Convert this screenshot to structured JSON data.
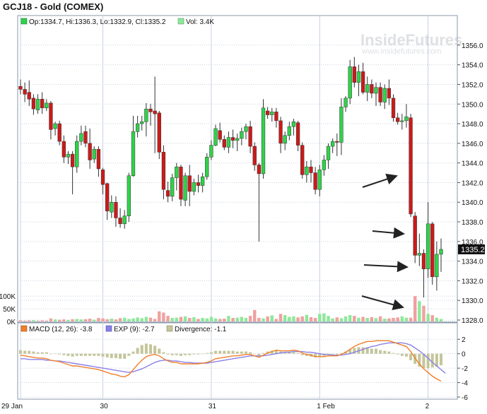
{
  "header": {
    "title": "GCJ18 - Gold (COMEX)",
    "ohlc": "Op:1334.7, Hi:1336.3, Lo:1332.9, Cl:1335.2",
    "vol": "Vol: 3.4K"
  },
  "watermark": {
    "brand": "InsideFutures",
    "url": "www.insidefutures.com"
  },
  "colors": {
    "up": "#2fd34a",
    "down": "#cc1a1a",
    "vol_up": "#8ee89a",
    "vol_down": "#f0a0a0",
    "macd": "#ef7f2a",
    "exp": "#8a80e8",
    "divergence": "#c4c59a",
    "grid": "#c8d0e0",
    "arrow": "#222222"
  },
  "chart_data": [
    {
      "type": "candlestick",
      "name": "price",
      "title": "GCJ18 - Gold (COMEX)",
      "ylim": [
        1328.0,
        1357.0
      ],
      "yticks": [
        "1356.0",
        "1354.0",
        "1352.0",
        "1350.0",
        "1348.0",
        "1346.0",
        "1344.0",
        "1342.0",
        "1340.0",
        "1338.0",
        "1336.0",
        "1334.0",
        "1332.0",
        "1330.0",
        "1328.0"
      ],
      "last_price_label": "1335.2",
      "xticks": [
        "29 Jan",
        "30",
        "31",
        "1 Feb",
        "2"
      ],
      "candles": [
        {
          "o": 1351.8,
          "h": 1352.5,
          "l": 1351.0,
          "c": 1351.5
        },
        {
          "o": 1351.5,
          "h": 1352.2,
          "l": 1350.2,
          "c": 1351.0
        },
        {
          "o": 1351.2,
          "h": 1352.4,
          "l": 1349.8,
          "c": 1350.5
        },
        {
          "o": 1350.6,
          "h": 1351.0,
          "l": 1348.9,
          "c": 1349.5
        },
        {
          "o": 1349.4,
          "h": 1351.0,
          "l": 1349.0,
          "c": 1350.5
        },
        {
          "o": 1350.5,
          "h": 1351.2,
          "l": 1349.0,
          "c": 1349.6
        },
        {
          "o": 1349.6,
          "h": 1350.5,
          "l": 1349.3,
          "c": 1350.1
        },
        {
          "o": 1350.1,
          "h": 1350.3,
          "l": 1346.4,
          "c": 1347.4
        },
        {
          "o": 1347.5,
          "h": 1348.2,
          "l": 1346.8,
          "c": 1348.0
        },
        {
          "o": 1348.0,
          "h": 1348.3,
          "l": 1345.8,
          "c": 1346.2
        },
        {
          "o": 1346.2,
          "h": 1346.8,
          "l": 1344.0,
          "c": 1344.6
        },
        {
          "o": 1344.6,
          "h": 1345.2,
          "l": 1343.9,
          "c": 1344.9
        },
        {
          "o": 1344.9,
          "h": 1345.2,
          "l": 1340.8,
          "c": 1343.6
        },
        {
          "o": 1343.6,
          "h": 1346.8,
          "l": 1343.0,
          "c": 1346.2
        },
        {
          "o": 1346.2,
          "h": 1347.8,
          "l": 1345.8,
          "c": 1347.0
        },
        {
          "o": 1347.2,
          "h": 1347.8,
          "l": 1345.6,
          "c": 1346.0
        },
        {
          "o": 1346.0,
          "h": 1347.5,
          "l": 1343.4,
          "c": 1344.3
        },
        {
          "o": 1344.4,
          "h": 1345.7,
          "l": 1344.0,
          "c": 1345.4
        },
        {
          "o": 1345.4,
          "h": 1345.7,
          "l": 1342.6,
          "c": 1343.4
        },
        {
          "o": 1343.3,
          "h": 1343.5,
          "l": 1340.8,
          "c": 1341.8
        },
        {
          "o": 1341.9,
          "h": 1342.0,
          "l": 1338.2,
          "c": 1339.1
        },
        {
          "o": 1339.0,
          "h": 1340.7,
          "l": 1338.4,
          "c": 1340.0
        },
        {
          "o": 1340.0,
          "h": 1340.6,
          "l": 1337.5,
          "c": 1338.4
        },
        {
          "o": 1338.4,
          "h": 1339.4,
          "l": 1337.4,
          "c": 1337.8
        },
        {
          "o": 1337.8,
          "h": 1339.2,
          "l": 1337.3,
          "c": 1338.6
        },
        {
          "o": 1338.6,
          "h": 1343.0,
          "l": 1338.0,
          "c": 1342.7
        },
        {
          "o": 1342.7,
          "h": 1348.8,
          "l": 1342.6,
          "c": 1347.2
        },
        {
          "o": 1347.2,
          "h": 1348.8,
          "l": 1346.6,
          "c": 1348.0
        },
        {
          "o": 1348.0,
          "h": 1348.8,
          "l": 1347.3,
          "c": 1348.2
        },
        {
          "o": 1348.2,
          "h": 1350.1,
          "l": 1346.7,
          "c": 1349.5
        },
        {
          "o": 1349.5,
          "h": 1350.0,
          "l": 1347.8,
          "c": 1349.2
        },
        {
          "o": 1349.3,
          "h": 1352.8,
          "l": 1345.0,
          "c": 1349.0
        },
        {
          "o": 1349.1,
          "h": 1349.3,
          "l": 1344.4,
          "c": 1345.1
        },
        {
          "o": 1345.1,
          "h": 1345.8,
          "l": 1340.3,
          "c": 1341.3
        },
        {
          "o": 1341.2,
          "h": 1342.1,
          "l": 1340.0,
          "c": 1340.6
        },
        {
          "o": 1340.6,
          "h": 1342.9,
          "l": 1340.1,
          "c": 1342.5
        },
        {
          "o": 1342.5,
          "h": 1344.0,
          "l": 1341.2,
          "c": 1343.6
        },
        {
          "o": 1343.6,
          "h": 1343.8,
          "l": 1339.6,
          "c": 1340.3
        },
        {
          "o": 1340.2,
          "h": 1343.0,
          "l": 1339.6,
          "c": 1342.7
        },
        {
          "o": 1342.7,
          "h": 1343.8,
          "l": 1339.6,
          "c": 1341.1
        },
        {
          "o": 1341.1,
          "h": 1342.4,
          "l": 1340.7,
          "c": 1342.0
        },
        {
          "o": 1342.0,
          "h": 1342.8,
          "l": 1341.0,
          "c": 1341.7
        },
        {
          "o": 1341.7,
          "h": 1343.0,
          "l": 1341.0,
          "c": 1342.6
        },
        {
          "o": 1342.6,
          "h": 1345.0,
          "l": 1342.3,
          "c": 1344.6
        },
        {
          "o": 1344.6,
          "h": 1346.3,
          "l": 1344.3,
          "c": 1345.8
        },
        {
          "o": 1345.8,
          "h": 1347.9,
          "l": 1345.7,
          "c": 1347.5
        },
        {
          "o": 1347.3,
          "h": 1348.1,
          "l": 1346.1,
          "c": 1346.4
        },
        {
          "o": 1346.4,
          "h": 1346.8,
          "l": 1345.3,
          "c": 1345.6
        },
        {
          "o": 1345.6,
          "h": 1347.2,
          "l": 1345.0,
          "c": 1346.6
        },
        {
          "o": 1346.6,
          "h": 1347.4,
          "l": 1345.5,
          "c": 1346.3
        },
        {
          "o": 1346.3,
          "h": 1347.0,
          "l": 1345.2,
          "c": 1346.5
        },
        {
          "o": 1346.5,
          "h": 1347.6,
          "l": 1345.8,
          "c": 1347.2
        },
        {
          "o": 1347.2,
          "h": 1348.0,
          "l": 1346.4,
          "c": 1347.7
        },
        {
          "o": 1347.7,
          "h": 1348.3,
          "l": 1345.0,
          "c": 1345.7
        },
        {
          "o": 1345.7,
          "h": 1346.1,
          "l": 1343.2,
          "c": 1343.8
        },
        {
          "o": 1343.8,
          "h": 1344.0,
          "l": 1336.0,
          "c": 1342.9
        },
        {
          "o": 1342.9,
          "h": 1350.5,
          "l": 1342.4,
          "c": 1349.6
        },
        {
          "o": 1349.3,
          "h": 1349.7,
          "l": 1348.5,
          "c": 1348.9
        },
        {
          "o": 1348.9,
          "h": 1349.6,
          "l": 1348.2,
          "c": 1349.2
        },
        {
          "o": 1349.2,
          "h": 1349.6,
          "l": 1347.6,
          "c": 1348.3
        },
        {
          "o": 1348.3,
          "h": 1348.7,
          "l": 1345.0,
          "c": 1346.0
        },
        {
          "o": 1346.0,
          "h": 1347.2,
          "l": 1345.3,
          "c": 1346.8
        },
        {
          "o": 1346.8,
          "h": 1348.2,
          "l": 1346.3,
          "c": 1347.7
        },
        {
          "o": 1347.7,
          "h": 1348.5,
          "l": 1346.8,
          "c": 1348.2
        },
        {
          "o": 1348.1,
          "h": 1348.3,
          "l": 1345.2,
          "c": 1345.8
        },
        {
          "o": 1345.8,
          "h": 1346.1,
          "l": 1342.4,
          "c": 1342.8
        },
        {
          "o": 1342.8,
          "h": 1344.2,
          "l": 1342.0,
          "c": 1343.6
        },
        {
          "o": 1343.6,
          "h": 1344.3,
          "l": 1342.0,
          "c": 1343.0
        },
        {
          "o": 1343.0,
          "h": 1343.6,
          "l": 1340.8,
          "c": 1341.3
        },
        {
          "o": 1341.3,
          "h": 1343.8,
          "l": 1340.6,
          "c": 1343.3
        },
        {
          "o": 1343.3,
          "h": 1344.8,
          "l": 1342.7,
          "c": 1344.3
        },
        {
          "o": 1344.3,
          "h": 1346.0,
          "l": 1343.4,
          "c": 1345.7
        },
        {
          "o": 1345.7,
          "h": 1346.5,
          "l": 1345.0,
          "c": 1346.2
        },
        {
          "o": 1346.2,
          "h": 1347.0,
          "l": 1344.7,
          "c": 1346.1
        },
        {
          "o": 1346.1,
          "h": 1350.6,
          "l": 1344.8,
          "c": 1349.7
        },
        {
          "o": 1349.7,
          "h": 1350.8,
          "l": 1349.2,
          "c": 1350.6
        },
        {
          "o": 1350.6,
          "h": 1354.5,
          "l": 1350.0,
          "c": 1353.8
        },
        {
          "o": 1353.8,
          "h": 1354.8,
          "l": 1351.7,
          "c": 1352.2
        },
        {
          "o": 1352.2,
          "h": 1354.0,
          "l": 1350.8,
          "c": 1353.3
        },
        {
          "o": 1353.3,
          "h": 1354.2,
          "l": 1351.0,
          "c": 1351.2
        },
        {
          "o": 1351.2,
          "h": 1352.8,
          "l": 1350.3,
          "c": 1352.0
        },
        {
          "o": 1352.0,
          "h": 1352.5,
          "l": 1350.6,
          "c": 1351.1
        },
        {
          "o": 1351.1,
          "h": 1352.2,
          "l": 1349.8,
          "c": 1351.7
        },
        {
          "o": 1351.7,
          "h": 1352.2,
          "l": 1349.8,
          "c": 1350.2
        },
        {
          "o": 1350.2,
          "h": 1352.0,
          "l": 1349.5,
          "c": 1351.6
        },
        {
          "o": 1351.6,
          "h": 1352.5,
          "l": 1349.9,
          "c": 1350.6
        },
        {
          "o": 1350.6,
          "h": 1351.0,
          "l": 1348.2,
          "c": 1348.6
        },
        {
          "o": 1348.6,
          "h": 1349.1,
          "l": 1347.9,
          "c": 1348.2
        },
        {
          "o": 1348.2,
          "h": 1349.0,
          "l": 1347.4,
          "c": 1348.3
        },
        {
          "o": 1348.3,
          "h": 1350.0,
          "l": 1347.6,
          "c": 1348.7
        },
        {
          "o": 1348.6,
          "h": 1349.0,
          "l": 1338.5,
          "c": 1338.8
        },
        {
          "o": 1338.6,
          "h": 1339.0,
          "l": 1333.8,
          "c": 1334.6
        },
        {
          "o": 1334.6,
          "h": 1336.8,
          "l": 1333.5,
          "c": 1334.8
        },
        {
          "o": 1334.8,
          "h": 1335.2,
          "l": 1330.3,
          "c": 1333.2
        },
        {
          "o": 1333.2,
          "h": 1340.0,
          "l": 1332.3,
          "c": 1337.8
        },
        {
          "o": 1337.8,
          "h": 1338.0,
          "l": 1331.6,
          "c": 1332.4
        },
        {
          "o": 1332.4,
          "h": 1336.0,
          "l": 1331.0,
          "c": 1334.7
        },
        {
          "o": 1334.7,
          "h": 1336.3,
          "l": 1332.9,
          "c": 1335.2
        }
      ]
    },
    {
      "type": "bar",
      "name": "volume",
      "ylim": [
        0,
        120
      ],
      "yticks": [
        "100K",
        "50K",
        "0K"
      ],
      "values": [
        4,
        3,
        4,
        5,
        3,
        4,
        3,
        12,
        8,
        7,
        8,
        6,
        9,
        10,
        8,
        9,
        11,
        7,
        14,
        12,
        9,
        11,
        8,
        13,
        15,
        10,
        12,
        16,
        13,
        18,
        15,
        10,
        40,
        35,
        22,
        14,
        15,
        18,
        20,
        14,
        17,
        10,
        14,
        12,
        18,
        12,
        10,
        11,
        22,
        14,
        15,
        18,
        14,
        22,
        45,
        14,
        12,
        20,
        24,
        10,
        30,
        25,
        18,
        20,
        16,
        20,
        26,
        17,
        14,
        30,
        32,
        22,
        12,
        16,
        13,
        20,
        25,
        22,
        15,
        18,
        14,
        17,
        13,
        20,
        11,
        12,
        14,
        16,
        20,
        15,
        15,
        100,
        80,
        62,
        30,
        25,
        15,
        10
      ],
      "up": [
        0,
        0,
        0,
        1,
        0,
        0,
        0,
        0,
        1,
        0,
        0,
        1,
        0,
        1,
        1,
        0,
        0,
        1,
        0,
        0,
        0,
        1,
        0,
        0,
        1,
        1,
        1,
        1,
        1,
        1,
        0,
        0,
        0,
        0,
        0,
        1,
        1,
        0,
        1,
        0,
        1,
        0,
        1,
        1,
        1,
        1,
        0,
        0,
        1,
        0,
        1,
        1,
        1,
        0,
        0,
        0,
        1,
        0,
        1,
        0,
        0,
        1,
        1,
        1,
        0,
        0,
        1,
        0,
        0,
        1,
        1,
        1,
        1,
        0,
        1,
        1,
        1,
        0,
        1,
        0,
        1,
        0,
        1,
        0,
        1,
        0,
        0,
        0,
        1,
        1,
        0,
        0,
        1,
        0,
        1,
        0,
        1,
        1
      ]
    },
    {
      "type": "line",
      "name": "macd",
      "ylim": [
        -6,
        3
      ],
      "yticks": [
        "2",
        "0",
        "-2",
        "-4",
        "-6"
      ],
      "legend": [
        "MACD (12, 26): -3.8",
        "EXP (9): -2.7",
        "Divergence: -1.1"
      ],
      "macd": [
        -0.2,
        -0.3,
        -0.4,
        -0.5,
        -0.6,
        -0.6,
        -0.7,
        -0.9,
        -1.0,
        -1.1,
        -1.3,
        -1.5,
        -1.7,
        -1.7,
        -1.8,
        -1.9,
        -2.0,
        -2.1,
        -2.2,
        -2.4,
        -2.6,
        -2.8,
        -2.9,
        -3.1,
        -3.2,
        -2.9,
        -2.2,
        -1.5,
        -0.9,
        -0.4,
        -0.2,
        -0.1,
        -0.3,
        -0.7,
        -1.0,
        -1.2,
        -1.2,
        -1.4,
        -1.4,
        -1.4,
        -1.4,
        -1.4,
        -1.3,
        -1.2,
        -1.0,
        -0.7,
        -0.6,
        -0.5,
        -0.4,
        -0.3,
        -0.3,
        -0.2,
        -0.1,
        -0.1,
        -0.3,
        -0.5,
        -0.2,
        0.1,
        0.3,
        0.5,
        0.4,
        0.4,
        0.4,
        0.5,
        0.4,
        0.1,
        -0.1,
        -0.2,
        -0.4,
        -0.4,
        -0.4,
        -0.3,
        -0.3,
        -0.3,
        -0.1,
        0.2,
        0.6,
        1.0,
        1.3,
        1.5,
        1.7,
        1.7,
        1.8,
        1.8,
        1.8,
        1.8,
        1.6,
        1.4,
        1.2,
        1.0,
        0.3,
        -0.6,
        -1.4,
        -2.1,
        -2.6,
        -3.1,
        -3.5,
        -3.8
      ],
      "exp": [
        -0.7,
        -0.7,
        -0.8,
        -0.8,
        -0.8,
        -0.8,
        -0.9,
        -0.9,
        -1.0,
        -1.0,
        -1.1,
        -1.2,
        -1.3,
        -1.4,
        -1.5,
        -1.6,
        -1.7,
        -1.8,
        -1.9,
        -2.0,
        -2.1,
        -2.2,
        -2.3,
        -2.4,
        -2.5,
        -2.6,
        -2.5,
        -2.3,
        -2.1,
        -1.8,
        -1.5,
        -1.2,
        -1.0,
        -0.9,
        -0.9,
        -1.0,
        -1.0,
        -1.1,
        -1.2,
        -1.2,
        -1.3,
        -1.3,
        -1.3,
        -1.3,
        -1.2,
        -1.1,
        -1.0,
        -0.9,
        -0.8,
        -0.7,
        -0.6,
        -0.5,
        -0.4,
        -0.3,
        -0.3,
        -0.3,
        -0.3,
        -0.2,
        -0.1,
        0.0,
        0.1,
        0.2,
        0.2,
        0.3,
        0.3,
        0.3,
        0.2,
        0.2,
        0.1,
        0.0,
        -0.1,
        -0.1,
        -0.2,
        -0.2,
        -0.2,
        -0.1,
        0.0,
        0.2,
        0.4,
        0.6,
        0.8,
        1.0,
        1.1,
        1.3,
        1.4,
        1.5,
        1.5,
        1.5,
        1.5,
        1.4,
        1.2,
        0.8,
        0.4,
        -0.1,
        -0.6,
        -1.2,
        -1.7,
        -2.2,
        -2.7
      ]
    }
  ]
}
